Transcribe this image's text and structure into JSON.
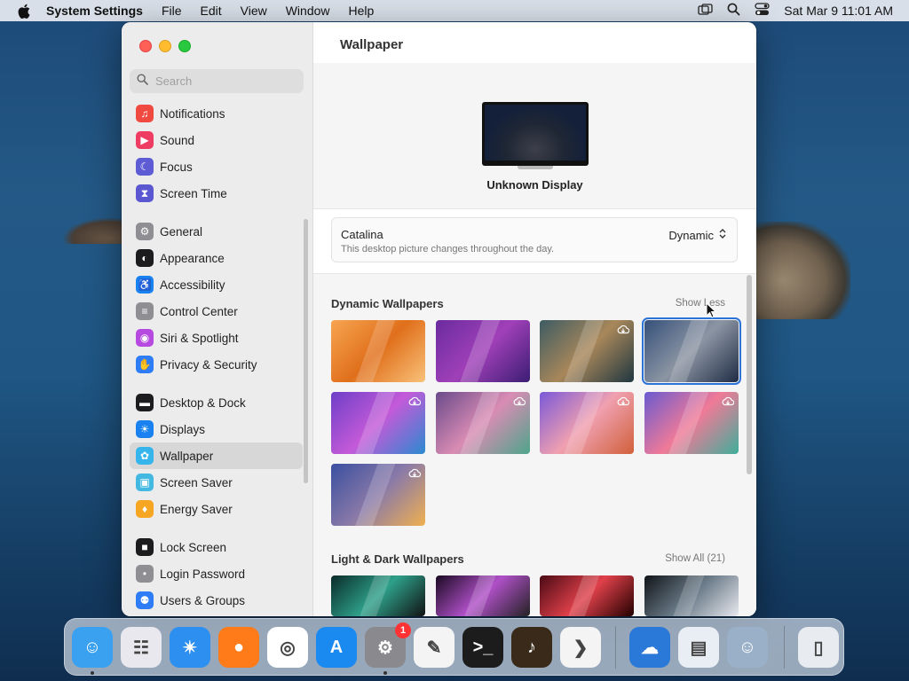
{
  "menubar": {
    "app_name": "System Settings",
    "items": [
      "File",
      "Edit",
      "View",
      "Window",
      "Help"
    ],
    "clock": "Sat Mar 9  11:01 AM"
  },
  "sidebar": {
    "search_placeholder": "Search",
    "groups": [
      [
        {
          "label": "Notifications",
          "icon": "bell-icon",
          "color": "#f04a40"
        },
        {
          "label": "Sound",
          "icon": "speaker-icon",
          "color": "#ef3c62"
        },
        {
          "label": "Focus",
          "icon": "moon-icon",
          "color": "#5d5cd4"
        },
        {
          "label": "Screen Time",
          "icon": "hourglass-icon",
          "color": "#5b57d0"
        }
      ],
      [
        {
          "label": "General",
          "icon": "gear-icon",
          "color": "#8e8e93"
        },
        {
          "label": "Appearance",
          "icon": "appearance-icon",
          "color": "#1c1c1e"
        },
        {
          "label": "Accessibility",
          "icon": "accessibility-icon",
          "color": "#1a82f0"
        },
        {
          "label": "Control Center",
          "icon": "toggles-icon",
          "color": "#8e8e93"
        },
        {
          "label": "Siri & Spotlight",
          "icon": "siri-icon",
          "color": "#b64ae0"
        },
        {
          "label": "Privacy & Security",
          "icon": "hand-icon",
          "color": "#2f7df6"
        }
      ],
      [
        {
          "label": "Desktop & Dock",
          "icon": "dock-icon",
          "color": "#1c1c1e"
        },
        {
          "label": "Displays",
          "icon": "sun-icon",
          "color": "#1a82f0"
        },
        {
          "label": "Wallpaper",
          "icon": "flower-icon",
          "color": "#35b5ec",
          "selected": true
        },
        {
          "label": "Screen Saver",
          "icon": "screensaver-icon",
          "color": "#43b8e0"
        },
        {
          "label": "Energy Saver",
          "icon": "bulb-icon",
          "color": "#f6a623"
        }
      ],
      [
        {
          "label": "Lock Screen",
          "icon": "lock-icon",
          "color": "#1c1c1e"
        },
        {
          "label": "Login Password",
          "icon": "padlock-icon",
          "color": "#8e8e93"
        },
        {
          "label": "Users & Groups",
          "icon": "users-icon",
          "color": "#2f7df6"
        }
      ]
    ]
  },
  "main": {
    "title": "Wallpaper",
    "display_name": "Unknown Display",
    "current": {
      "name": "Catalina",
      "description": "This desktop picture changes throughout the day.",
      "mode": "Dynamic"
    },
    "dynamic_section": {
      "title": "Dynamic Wallpapers",
      "link": "Show Less"
    },
    "light_dark_section": {
      "title": "Light & Dark Wallpapers",
      "link": "Show All (21)"
    }
  },
  "thumbnails": [
    {
      "name": "ventura",
      "cloud": false,
      "selected": false,
      "colors": [
        "#f7a552",
        "#e06f1b",
        "#f9c27a"
      ]
    },
    {
      "name": "monterey",
      "cloud": false,
      "selected": false,
      "colors": [
        "#6a2b9e",
        "#a040b8",
        "#3b1d73"
      ]
    },
    {
      "name": "big-sur-coast",
      "cloud": true,
      "selected": false,
      "colors": [
        "#3d5b63",
        "#a8875a",
        "#1f3640"
      ]
    },
    {
      "name": "catalina",
      "cloud": false,
      "selected": true,
      "colors": [
        "#35507a",
        "#8c95a3",
        "#1f2c45"
      ]
    },
    {
      "name": "big-sur-color-1",
      "cloud": true,
      "selected": false,
      "colors": [
        "#6d3fc8",
        "#c45ad8",
        "#2a8ad0"
      ]
    },
    {
      "name": "big-sur-color-2",
      "cloud": true,
      "selected": false,
      "colors": [
        "#6a4a8a",
        "#d98cb4",
        "#4da58a"
      ]
    },
    {
      "name": "big-sur-color-3",
      "cloud": true,
      "selected": false,
      "colors": [
        "#7a58d8",
        "#f0a0b0",
        "#d0603a"
      ]
    },
    {
      "name": "big-sur-color-4",
      "cloud": true,
      "selected": false,
      "colors": [
        "#6a5ad0",
        "#f07a98",
        "#3fae9a"
      ]
    },
    {
      "name": "hello-gradient",
      "cloud": true,
      "selected": false,
      "colors": [
        "#3a4fa0",
        "#8a7aa8",
        "#f0b050"
      ]
    }
  ],
  "light_dark_thumbs": [
    {
      "name": "ld-1",
      "colors": [
        "#0a2a28",
        "#2ea08a",
        "#111"
      ]
    },
    {
      "name": "ld-2",
      "colors": [
        "#1a0a22",
        "#b050c8",
        "#222"
      ]
    },
    {
      "name": "ld-3",
      "colors": [
        "#4a0a14",
        "#e0404a",
        "#200"
      ]
    },
    {
      "name": "ld-4",
      "colors": [
        "#101418",
        "#6a7a88",
        "#e8e8ee"
      ]
    }
  ],
  "dock": {
    "apps": [
      {
        "name": "Finder",
        "icon": "finder-icon",
        "color": "#3aa0f0",
        "running": true
      },
      {
        "name": "Launchpad",
        "icon": "launchpad-icon",
        "color": "#e8e8ee"
      },
      {
        "name": "Safari",
        "icon": "safari-icon",
        "color": "#2d8ff0"
      },
      {
        "name": "Firefox",
        "icon": "firefox-icon",
        "color": "#ff7a18"
      },
      {
        "name": "Chrome",
        "icon": "chrome-icon",
        "color": "#ffffff"
      },
      {
        "name": "App Store",
        "icon": "appstore-icon",
        "color": "#1a8af0"
      },
      {
        "name": "System Settings",
        "icon": "settings-icon",
        "color": "#8a8a8e",
        "running": true,
        "badge": "1"
      },
      {
        "name": "TextEdit",
        "icon": "textedit-icon",
        "color": "#f4f4f4"
      },
      {
        "name": "Terminal",
        "icon": "terminal-icon",
        "color": "#1c1c1c"
      },
      {
        "name": "Instruments",
        "icon": "guitar-icon",
        "color": "#3a2a1a"
      },
      {
        "name": "VS Code",
        "icon": "vscode-icon",
        "color": "#f4f4f4"
      },
      {
        "name": "Weather",
        "icon": "weather-icon",
        "color": "#2a78d8"
      },
      {
        "name": "Preview",
        "icon": "preview-icon",
        "color": "#e8eef4"
      },
      {
        "name": "Finder Copy",
        "icon": "finder2-icon",
        "color": "#9ab0c8"
      },
      {
        "name": "Trash",
        "icon": "trash-icon",
        "color": "#e8ecf0"
      }
    ]
  }
}
